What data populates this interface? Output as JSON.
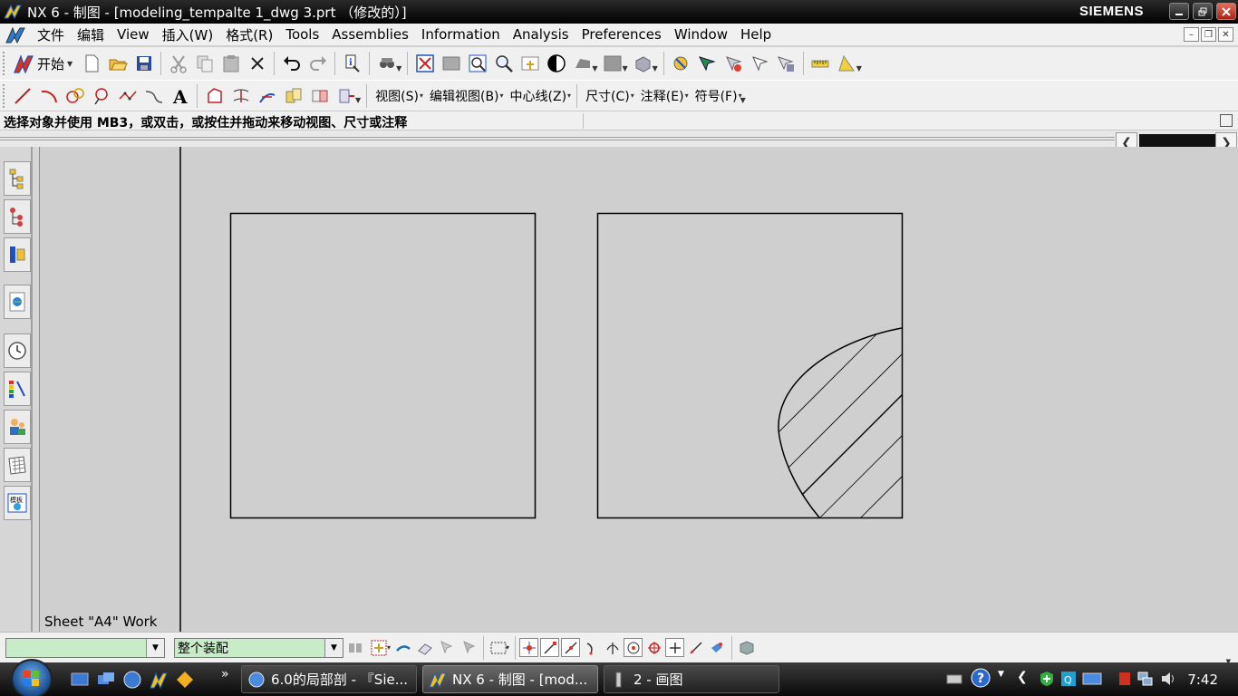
{
  "window": {
    "title": "NX 6 - 制图 - [modeling_tempalte 1_dwg 3.prt （修改的）]",
    "brand": "SIEMENS"
  },
  "menu": {
    "items": [
      "文件",
      "编辑",
      "View",
      "插入(W)",
      "格式(R)",
      "Tools",
      "Assemblies",
      "Information",
      "Analysis",
      "Preferences",
      "Window",
      "Help"
    ]
  },
  "toolbar1": {
    "start_label": "开始"
  },
  "toolbar2": {
    "menus": [
      "视图(S)",
      "编辑视图(B)",
      "中心线(Z)",
      "尺寸(C)",
      "注释(E)",
      "符号(F)"
    ]
  },
  "cue_line": {
    "text": "选择对象并使用 MB3，或双击，或按住并拖动来移动视图、尺寸或注释"
  },
  "sheet": {
    "label": "Sheet \"A4\" Work"
  },
  "selection_bar": {
    "type_filter_value": "",
    "scope_value": "整个装配"
  },
  "taskbar": {
    "tasks": [
      "6.0的局部剖 - 『Sie...",
      "NX 6 - 制图 - [mod...",
      "2 - 画图"
    ],
    "more_label": "»",
    "clock": "7:42"
  },
  "colors": {
    "titlebar": "#000000",
    "graphics_bg": "#cfcfcf",
    "selection_fill": "#c8ecc8",
    "siemens_text": "#ffffff"
  }
}
